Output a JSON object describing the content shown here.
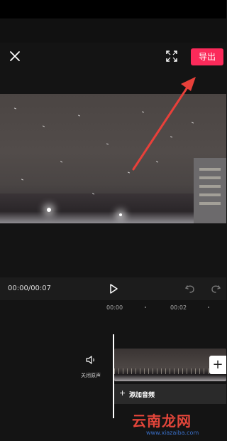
{
  "header": {
    "close_icon": "close-icon",
    "fullscreen_icon": "fullscreen-icon",
    "export_label": "导出"
  },
  "playback": {
    "time": "00:00/00:07",
    "play_icon": "play-icon",
    "undo_icon": "undo-icon",
    "redo_icon": "redo-icon"
  },
  "ruler": {
    "labels": [
      "00:00",
      "00:02"
    ]
  },
  "timeline": {
    "mute_label": "关闭原声",
    "add_audio_label": "添加音频",
    "add_clip_symbol": "+",
    "audio_plus_symbol": "+"
  },
  "watermark": {
    "title": "云南龙网",
    "url": "www.xiazaiba.com"
  },
  "colors": {
    "accent": "#fb2a5a",
    "annotation_arrow": "#e8403a",
    "background": "#141414"
  }
}
